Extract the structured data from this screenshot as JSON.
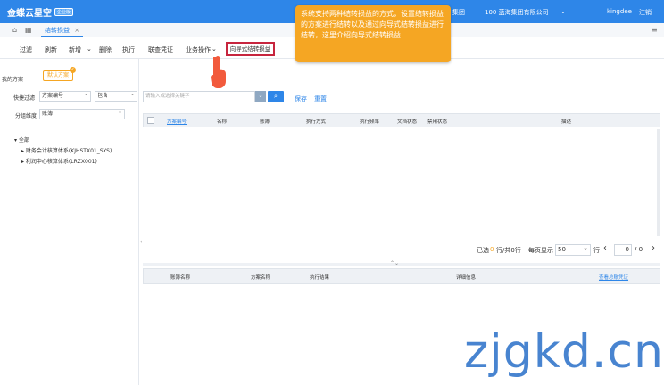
{
  "topbar": {
    "logo": "金蝶云星空",
    "logo_badge": "企业版",
    "group": "集团",
    "org": "100 蓝海集团有限公司",
    "user": "kingdee",
    "logout": "注销"
  },
  "tabs": {
    "active": "结转损益"
  },
  "toolbar": {
    "items": [
      "过滤",
      "刷新",
      "新增",
      "删除",
      "执行",
      "联查凭证",
      "业务操作"
    ],
    "wizard": "向导式结转损益"
  },
  "callout": "系统支持两种结转损益的方式，设置结转损益的方案进行结转以及通过向导式结转损益进行结转，这里介绍向导式结转损益",
  "left": {
    "my_scheme_label": "我的方案",
    "default_scheme": "默认方案",
    "quick_filter_label": "快捷过滤",
    "field_value": "方案编号",
    "op_value": "包含",
    "group_label": "分组维度",
    "group_value": "账簿",
    "tree": [
      "全部",
      "财务会计核算体系(KJHSTX01_SYS)",
      "利润中心核算体系(LRZX001)"
    ]
  },
  "search": {
    "placeholder": "请输入或选择关键字",
    "save": "保存",
    "reset": "重置"
  },
  "grid": {
    "columns": [
      "方案编号",
      "名称",
      "账簿",
      "执行方式",
      "执行频率",
      "文档状态",
      "禁用状态",
      "描述"
    ]
  },
  "pager": {
    "selected_label": "已选",
    "selected_count": "0",
    "rest": "行/共0行",
    "per_page_label": "每页显示",
    "per_page": "50",
    "row_unit": "行",
    "page": "0",
    "total": "/ 0"
  },
  "grid2": {
    "columns": [
      "账簿名称",
      "方案名称",
      "执行结果",
      "详细信息"
    ],
    "link": "查看总账凭证"
  },
  "watermark": "zjgkd.cn"
}
